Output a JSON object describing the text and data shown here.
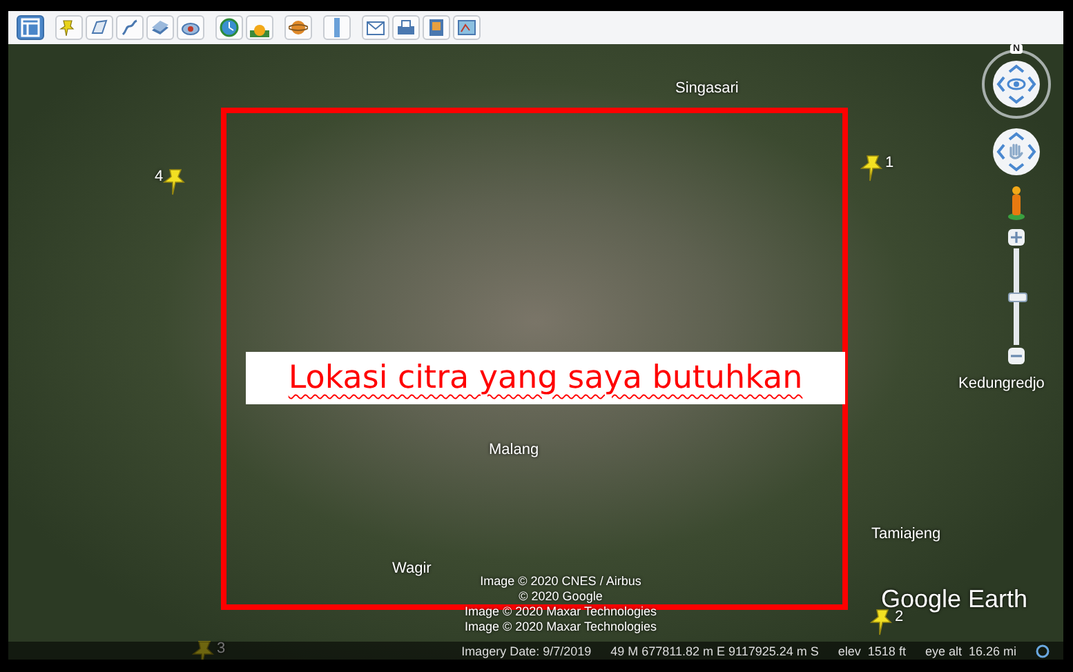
{
  "toolbar": [
    {
      "kind": "sidebar",
      "on": true
    },
    {
      "kind": "placemark",
      "on": false
    },
    {
      "kind": "polygon",
      "on": false
    },
    {
      "kind": "path",
      "on": false
    },
    {
      "kind": "overlay",
      "on": false
    },
    {
      "kind": "tour",
      "on": false
    },
    {
      "kind": "history",
      "on": false
    },
    {
      "kind": "sun",
      "on": false
    },
    {
      "kind": "planet",
      "on": false
    },
    {
      "kind": "ruler",
      "on": false
    },
    {
      "kind": "email",
      "on": false
    },
    {
      "kind": "print",
      "on": false
    },
    {
      "kind": "save-image",
      "on": false
    },
    {
      "kind": "maps",
      "on": false
    }
  ],
  "map": {
    "places": [
      "Singasari",
      "Kedungredjo",
      "Tamiajeng",
      "Wagir",
      "Malang"
    ],
    "pins": [
      {
        "label": "4"
      },
      {
        "label": "1"
      },
      {
        "label": "3"
      },
      {
        "label": "2"
      }
    ],
    "callout": "Lokasi citra yang saya butuhkan",
    "attribution": [
      "Image © 2020 CNES / Airbus",
      "© 2020 Google",
      "Image © 2020 Maxar Technologies",
      "Image © 2020 Maxar Technologies"
    ],
    "logo": "Google Earth",
    "navigation": {
      "compass_letter": "N",
      "zoom": {
        "level": 0.5
      }
    }
  },
  "status_bar": {
    "imagery_date": "Imagery Date: 9/7/2019",
    "coordinates": "49 M 677811.82 m E 9117925.24 m S",
    "elevation": "elev  1518 ft",
    "eye_altitude": "eye alt  16.26 mi"
  }
}
